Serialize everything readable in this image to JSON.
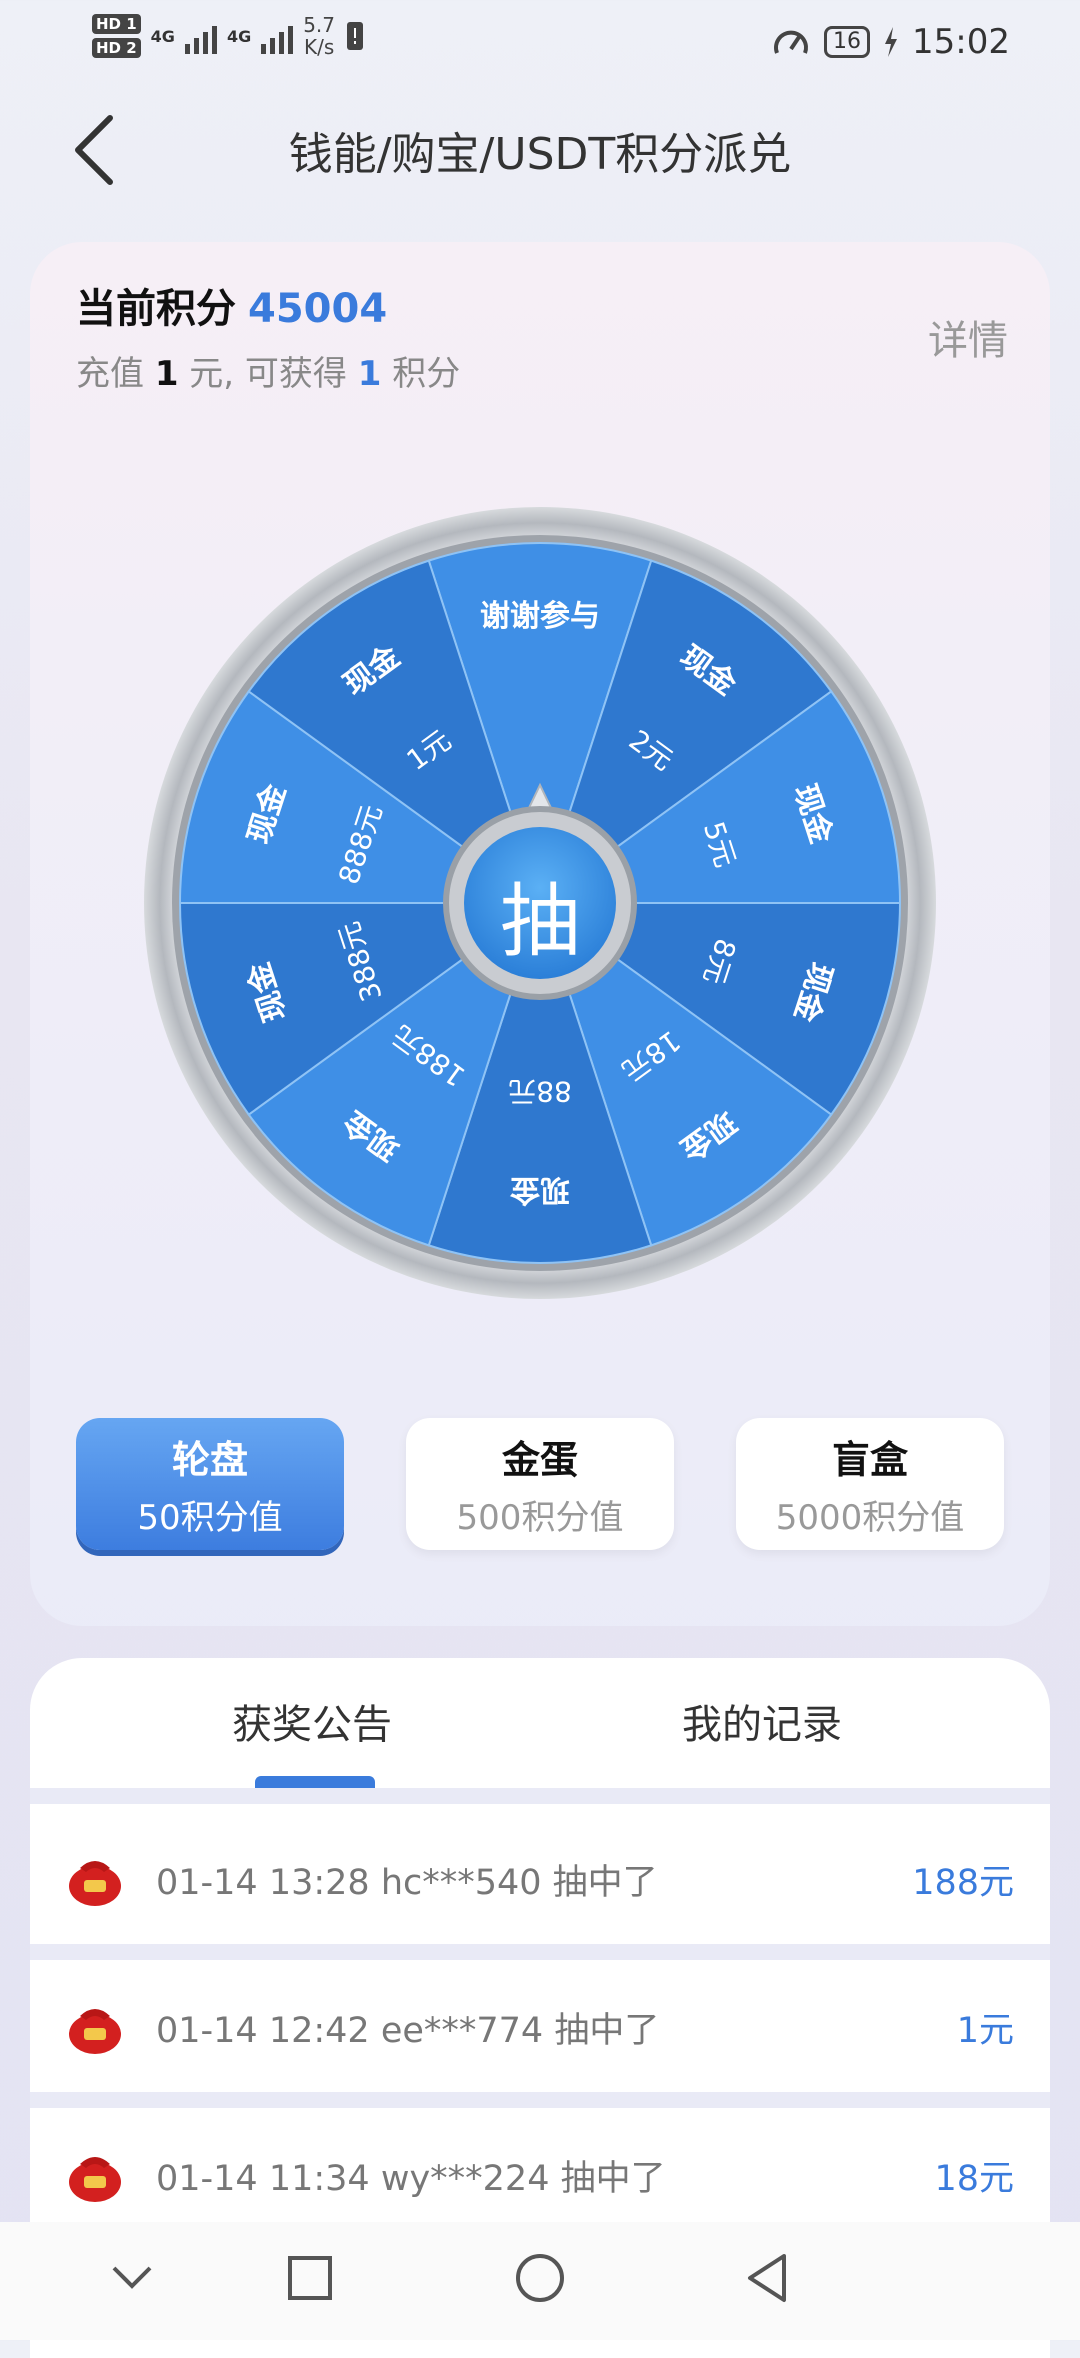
{
  "status_bar": {
    "hd1": "HD 1",
    "hd2": "HD 2",
    "net1": "4G",
    "net2": "4G",
    "speed_value": "5.7",
    "speed_unit": "K/s",
    "battery": "16",
    "time": "15:02"
  },
  "header": {
    "title": "钱能/购宝/USDT积分派兑"
  },
  "points": {
    "label": "当前积分",
    "value": "45004",
    "recharge_prefix": "充值",
    "recharge_amount": "1",
    "recharge_mid": "元, 可获得",
    "recharge_points": "1",
    "recharge_suffix": "积分",
    "details": "详情"
  },
  "wheel": {
    "center_label": "抽",
    "segments": [
      {
        "label": "谢谢参与",
        "amount": ""
      },
      {
        "label": "现金",
        "amount": "2元"
      },
      {
        "label": "现金",
        "amount": "5元"
      },
      {
        "label": "现金",
        "amount": "8元"
      },
      {
        "label": "现金",
        "amount": "18元"
      },
      {
        "label": "现金",
        "amount": "88元"
      },
      {
        "label": "现金",
        "amount": "188元"
      },
      {
        "label": "现金",
        "amount": "388元"
      },
      {
        "label": "现金",
        "amount": "888元"
      },
      {
        "label": "现金",
        "amount": "1元"
      }
    ],
    "colors": {
      "light": "#3f8fe6",
      "dark": "#2f78cf",
      "rim": "#bfc3c9"
    }
  },
  "modes": [
    {
      "name": "轮盘",
      "cost": "50积分值"
    },
    {
      "name": "金蛋",
      "cost": "500积分值"
    },
    {
      "name": "盲盒",
      "cost": "5000积分值"
    }
  ],
  "tabs": [
    "获奖公告",
    "我的记录"
  ],
  "records": [
    {
      "text": "01-14 13:28 hc***540 抽中了",
      "prize": "188元"
    },
    {
      "text": "01-14 12:42 ee***774 抽中了",
      "prize": "1元"
    },
    {
      "text": "01-14 11:34 wy***224 抽中了",
      "prize": "18元"
    }
  ],
  "navbar": {
    "icons": [
      "chevron-down-icon",
      "square-icon",
      "circle-icon",
      "back-triangle-icon"
    ]
  }
}
